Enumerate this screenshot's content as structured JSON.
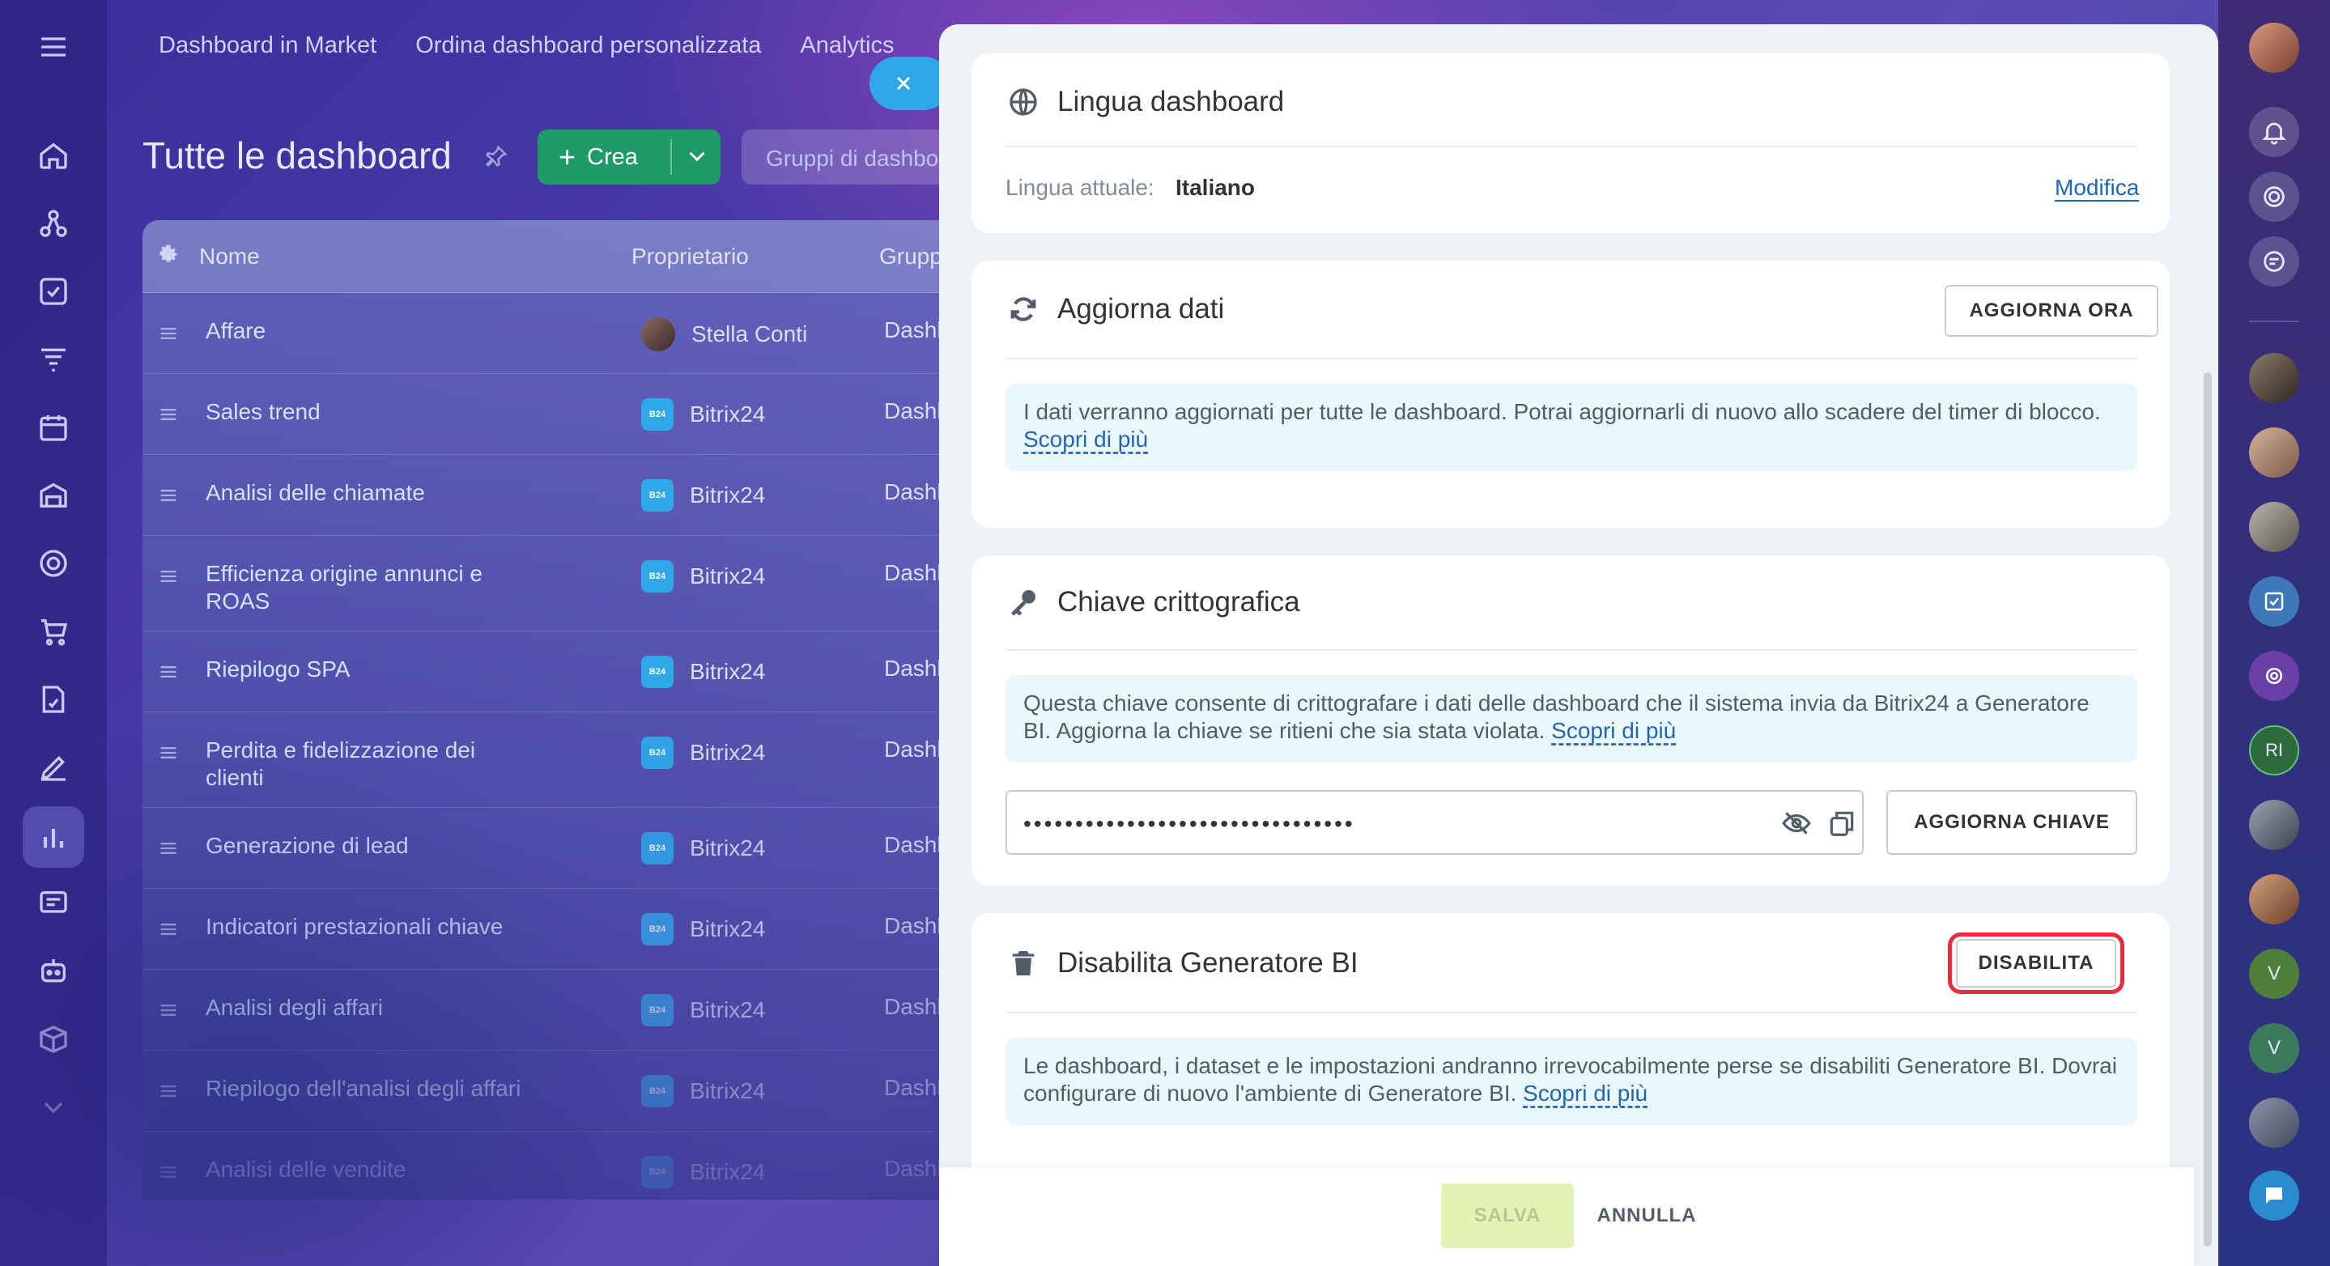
{
  "top_nav": [
    "Dashboard in Market",
    "Ordina dashboard personalizzata",
    "Analytics"
  ],
  "page": {
    "title": "Tutte le dashboard",
    "create_label": "Crea",
    "groups_placeholder": "Gruppi di dashboard"
  },
  "table": {
    "headers": {
      "name": "Nome",
      "owner": "Proprietario",
      "group": "Gruppo"
    },
    "rows": [
      {
        "name": "Affare",
        "owner": "Stella Conti",
        "owner_type": "user",
        "group": "Dashboard"
      },
      {
        "name": "Sales trend",
        "owner": "Bitrix24",
        "owner_type": "b24",
        "group": "Dashboard"
      },
      {
        "name": "Analisi delle chiamate",
        "owner": "Bitrix24",
        "owner_type": "b24",
        "group": "Dashboard"
      },
      {
        "name": "Efficienza origine annunci e ROAS",
        "owner": "Bitrix24",
        "owner_type": "b24",
        "group": "Dashboard"
      },
      {
        "name": "Riepilogo SPA",
        "owner": "Bitrix24",
        "owner_type": "b24",
        "group": "Dashboard"
      },
      {
        "name": "Perdita e fidelizzazione dei clienti",
        "owner": "Bitrix24",
        "owner_type": "b24",
        "group": "Dashboard"
      },
      {
        "name": "Generazione di lead",
        "owner": "Bitrix24",
        "owner_type": "b24",
        "group": "Dashboard"
      },
      {
        "name": "Indicatori prestazionali chiave",
        "owner": "Bitrix24",
        "owner_type": "b24",
        "group": "Dashboard"
      },
      {
        "name": "Analisi degli affari",
        "owner": "Bitrix24",
        "owner_type": "b24",
        "group": "Dashboard"
      },
      {
        "name": "Riepilogo dell'analisi degli affari",
        "owner": "Bitrix24",
        "owner_type": "b24",
        "group": "Dashboard"
      },
      {
        "name": "Analisi delle vendite",
        "owner": "Bitrix24",
        "owner_type": "b24",
        "group": "Dashboard"
      }
    ]
  },
  "b24_badge": "B24",
  "settings": {
    "language": {
      "title": "Lingua dashboard",
      "current_label": "Lingua attuale:",
      "current_value": "Italiano",
      "edit_link": "Modifica"
    },
    "refresh": {
      "title": "Aggiorna dati",
      "button": "AGGIORNA ORA",
      "info": "I dati verranno aggiornati per tutte le dashboard. Potrai aggiornarli di nuovo allo scadere del timer di blocco.",
      "learn_more": "Scopri di più"
    },
    "crypto": {
      "title": "Chiave crittografica",
      "info": "Questa chiave consente di crittografare i dati delle dashboard che il sistema invia da Bitrix24 a Generatore BI. Aggiorna la chiave se ritieni che sia stata violata.",
      "learn_more": "Scopri di più",
      "key_value": "••••••••••••••••••••••••••••••••",
      "button": "AGGIORNA CHIAVE"
    },
    "disable": {
      "title": "Disabilita Generatore BI",
      "button": "DISABILITA",
      "info": "Le dashboard, i dataset e le impostazioni andranno irrevocabilmente perse se disabiliti Generatore BI. Dovrai configurare di nuovo l'ambiente di Generatore BI.",
      "learn_more": "Scopri di più"
    }
  },
  "footer": {
    "save": "SALVA",
    "cancel": "ANNULLA"
  },
  "right_bar": {
    "initials_1": "RI",
    "initials_2": "V",
    "initials_3": "V"
  },
  "colors": {
    "accent": "#2fa7e9",
    "create": "#1f9b6a",
    "highlight": "#ea2b3d",
    "link": "#2066b0"
  }
}
